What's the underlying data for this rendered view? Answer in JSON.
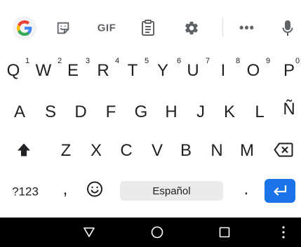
{
  "toolbar": {
    "icons": [
      "google-g-icon",
      "sticker-icon",
      "gif-icon",
      "clipboard-icon",
      "settings-icon",
      "more-icon",
      "microphone-icon"
    ],
    "gif_label": "GIF",
    "more_label": "•••",
    "colors": {
      "google_blue": "#4285F4",
      "google_red": "#EA4335",
      "google_yellow": "#FBBC05",
      "google_green": "#34A853",
      "icon_gray": "#5f6368"
    }
  },
  "rows": {
    "row1": [
      "Q",
      "W",
      "E",
      "R",
      "T",
      "Y",
      "U",
      "I",
      "O",
      "P"
    ],
    "row1_hints": [
      "1",
      "2",
      "3",
      "4",
      "5",
      "6",
      "7",
      "8",
      "9",
      "0"
    ],
    "row2": [
      "A",
      "S",
      "D",
      "F",
      "G",
      "H",
      "J",
      "K",
      "L",
      "Ñ"
    ],
    "row3": [
      "Z",
      "X",
      "C",
      "V",
      "B",
      "N",
      "M"
    ]
  },
  "bottom_row": {
    "symbols_label": "?123",
    "comma_label": ",",
    "emoji_icon": "emoji-icon",
    "space_label": "Español",
    "period_label": ".",
    "enter_icon": "enter-arrow-icon",
    "enter_color": "#1a73e8"
  },
  "special_keys": {
    "shift_icon": "shift-arrow-icon",
    "backspace_icon": "backspace-icon"
  },
  "navbar": {
    "icons": [
      "back-triangle-icon",
      "home-circle-icon",
      "recents-square-icon",
      "overflow-dots-icon"
    ]
  }
}
